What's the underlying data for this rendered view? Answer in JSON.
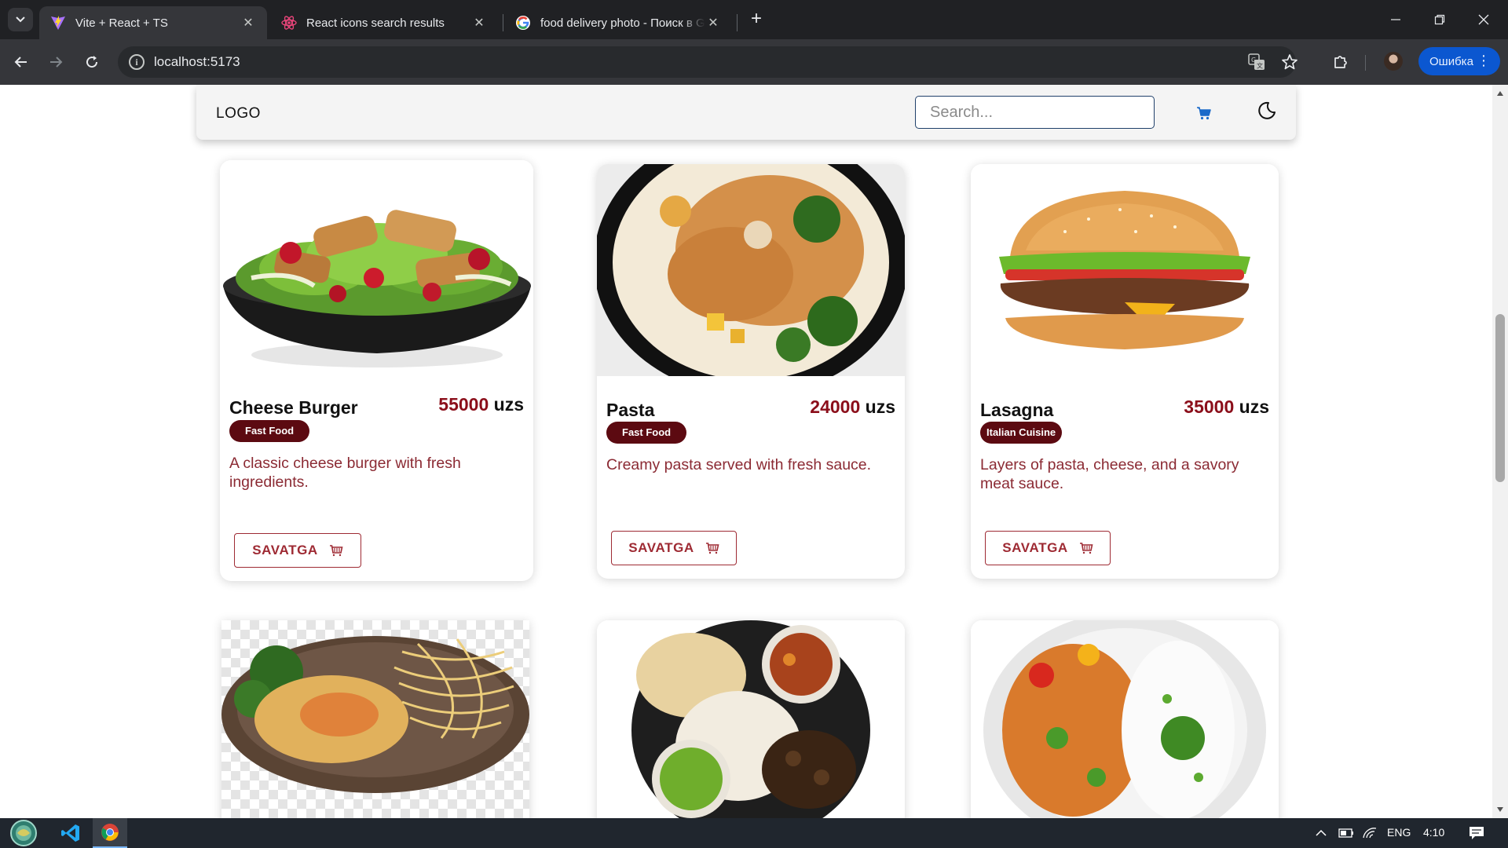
{
  "browser": {
    "tabs": [
      {
        "title": "Vite + React + TS",
        "active": true,
        "favicon": "vite-icon"
      },
      {
        "title": "React icons search results",
        "active": false,
        "favicon": "react-icon"
      },
      {
        "title": "food delivery photo - Поиск в Google",
        "active": false,
        "favicon": "google-icon"
      }
    ],
    "url": "localhost:5173",
    "profile_button": "Ошибка"
  },
  "site": {
    "logo": "LOGO",
    "search_placeholder": "Search..."
  },
  "products": [
    {
      "name": "Cheese Burger",
      "price": "55000",
      "currency": "uzs",
      "category": "Fast Food",
      "description": "A classic cheese burger with fresh ingredients.",
      "button": "SAVATGA",
      "image": "salad-bowl"
    },
    {
      "name": "Pasta",
      "price": "24000",
      "currency": "uzs",
      "category": "Fast Food",
      "description": "Creamy pasta served with fresh sauce.",
      "button": "SAVATGA",
      "image": "chicken-rice-bowl"
    },
    {
      "name": "Lasagna",
      "price": "35000",
      "currency": "uzs",
      "category": "Italian Cuisine",
      "description": "Layers of pasta, cheese, and a savory meat sauce.",
      "button": "SAVATGA",
      "image": "hamburger"
    },
    {
      "image": "chicken-spaghetti-plate"
    },
    {
      "image": "indian-thali-platter"
    },
    {
      "image": "curry-rice-plate"
    }
  ],
  "taskbar": {
    "language": "ENG",
    "time": "4:10"
  },
  "colors": {
    "price": "#8b0e1a",
    "badge": "#5c0a11",
    "accent_button": "#0b57d0"
  }
}
